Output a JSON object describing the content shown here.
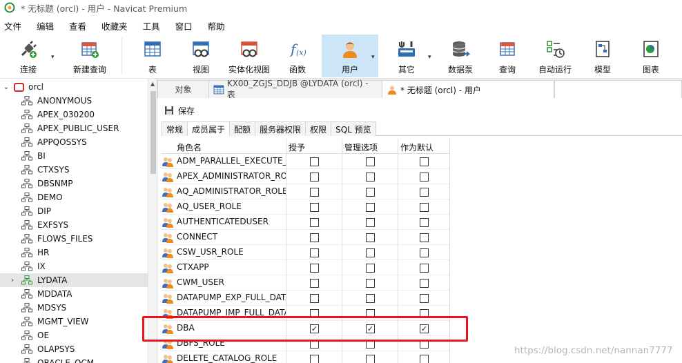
{
  "window": {
    "title": "* 无标题 (orcl) - 用户 - Navicat Premium"
  },
  "menu": [
    "文件",
    "编辑",
    "查看",
    "收藏夹",
    "工具",
    "窗口",
    "帮助"
  ],
  "toolbar": {
    "connect": "连接",
    "new_query": "新建查询",
    "table": "表",
    "view": "视图",
    "materialized_view": "实体化视图",
    "function": "函数",
    "user": "用户",
    "other": "其它",
    "data_pump": "数据泵",
    "query": "查询",
    "automation": "自动运行",
    "model": "模型",
    "chart": "图表"
  },
  "tree": {
    "root": "orcl",
    "items": [
      "ANONYMOUS",
      "APEX_030200",
      "APEX_PUBLIC_USER",
      "APPQOSSYS",
      "BI",
      "CTXSYS",
      "DBSNMP",
      "DEMO",
      "DIP",
      "EXFSYS",
      "FLOWS_FILES",
      "HR",
      "IX",
      "LYDATA",
      "MDDATA",
      "MDSYS",
      "MGMT_VIEW",
      "OE",
      "OLAPSYS",
      "ORACLE_OCM"
    ],
    "selected": "LYDATA"
  },
  "tabs": {
    "objects": "对象",
    "table_tab": "KX00_ZGJS_DDJB @LYDATA (orcl) - 表",
    "user_tab": "* 无标题 (orcl) - 用户"
  },
  "editor": {
    "save": "保存",
    "subtabs": [
      "常规",
      "成员属于",
      "配额",
      "服务器权限",
      "权限",
      "SQL 预览"
    ],
    "active_subtab": "成员属于",
    "columns": {
      "role_name": "角色名",
      "grant": "授予",
      "admin_option": "管理选项",
      "as_default": "作为默认"
    },
    "rows": [
      {
        "name": "ADM_PARALLEL_EXECUTE_TASK",
        "grant": false,
        "admin": false,
        "default": false
      },
      {
        "name": "APEX_ADMINISTRATOR_ROLE",
        "grant": false,
        "admin": false,
        "default": false
      },
      {
        "name": "AQ_ADMINISTRATOR_ROLE",
        "grant": false,
        "admin": false,
        "default": false
      },
      {
        "name": "AQ_USER_ROLE",
        "grant": false,
        "admin": false,
        "default": false
      },
      {
        "name": "AUTHENTICATEDUSER",
        "grant": false,
        "admin": false,
        "default": false
      },
      {
        "name": "CONNECT",
        "grant": false,
        "admin": false,
        "default": false
      },
      {
        "name": "CSW_USR_ROLE",
        "grant": false,
        "admin": false,
        "default": false
      },
      {
        "name": "CTXAPP",
        "grant": false,
        "admin": false,
        "default": false
      },
      {
        "name": "CWM_USER",
        "grant": false,
        "admin": false,
        "default": false
      },
      {
        "name": "DATAPUMP_EXP_FULL_DATABASE",
        "grant": false,
        "admin": false,
        "default": false
      },
      {
        "name": "DATAPUMP_IMP_FULL_DATABASE",
        "grant": false,
        "admin": false,
        "default": false
      },
      {
        "name": "DBA",
        "grant": true,
        "admin": true,
        "default": true
      },
      {
        "name": "DBFS_ROLE",
        "grant": false,
        "admin": false,
        "default": false
      },
      {
        "name": "DELETE_CATALOG_ROLE",
        "grant": false,
        "admin": false,
        "default": false
      }
    ]
  },
  "watermark": "https://blog.csdn.net/nannan7777",
  "colors": {
    "highlight": "#e8141c",
    "active_tool": "#cce6f8",
    "db_icon": "#d62a2a"
  }
}
